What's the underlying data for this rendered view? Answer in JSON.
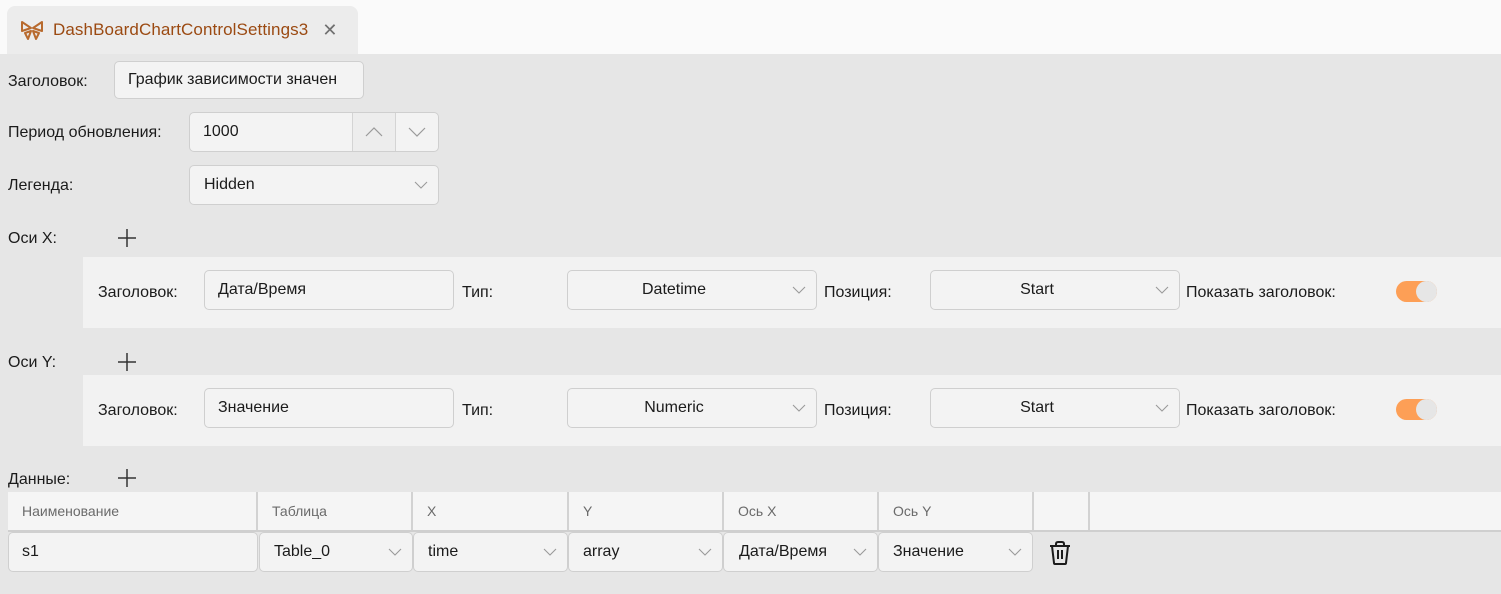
{
  "tab": {
    "title": "DashBoardChartControlSettings3",
    "icon": "butterfly-logo-icon",
    "close_icon": "close-icon",
    "accent_color": "#9b4a12"
  },
  "form": {
    "title_label": "Заголовок:",
    "title_value": "График зависимости значен",
    "period_label": "Период обновления:",
    "period_value": "1000",
    "legend_label": "Легенда:",
    "legend_value": "Hidden",
    "axes_x_label": "Оси X:",
    "axes_y_label": "Оси Y:",
    "data_label": "Данные:"
  },
  "axes_x": [
    {
      "title_label": "Заголовок:",
      "title_value": "Дата/Время",
      "type_label": "Тип:",
      "type_value": "Datetime",
      "position_label": "Позиция:",
      "position_value": "Start",
      "show_title_label": "Показать заголовок:",
      "show_title": true
    }
  ],
  "axes_y": [
    {
      "title_label": "Заголовок:",
      "title_value": "Значение",
      "type_label": "Тип:",
      "type_value": "Numeric",
      "position_label": "Позиция:",
      "position_value": "Start",
      "show_title_label": "Показать заголовок:",
      "show_title": true
    }
  ],
  "data_grid": {
    "columns": [
      "Наименование",
      "Таблица",
      "X",
      "Y",
      "Ось X",
      "Ось Y",
      ""
    ],
    "rows": [
      {
        "name": "s1",
        "table": "Table_0",
        "x": "time",
        "y": "array",
        "axis_x": "Дата/Время",
        "axis_y": "Значение"
      }
    ]
  },
  "colors": {
    "toggle_on": "#fd9f56",
    "background": "#e6e6e6",
    "panel": "#f2f2f2"
  }
}
